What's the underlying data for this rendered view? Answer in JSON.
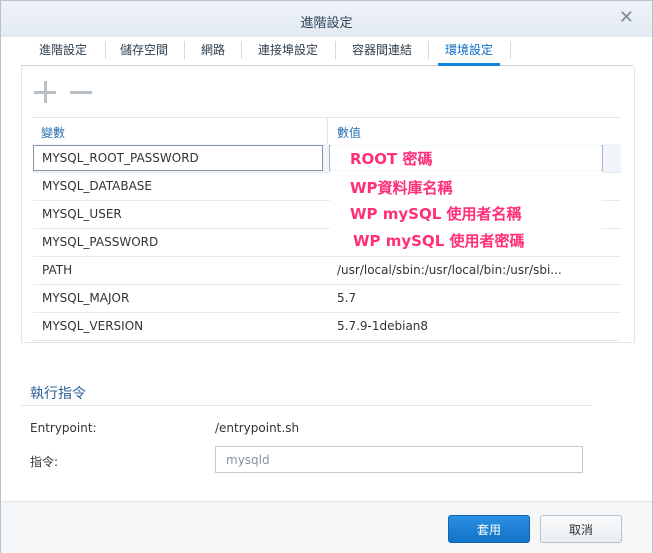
{
  "window": {
    "title": "進階設定"
  },
  "tabs": [
    {
      "label": "進階設定"
    },
    {
      "label": "儲存空間"
    },
    {
      "label": "網路"
    },
    {
      "label": "連接埠設定"
    },
    {
      "label": "容器間連結"
    },
    {
      "label": "環境設定",
      "active": true
    }
  ],
  "env": {
    "col_key": "變數",
    "col_value": "數值",
    "rows": [
      {
        "key": "MYSQL_ROOT_PASSWORD",
        "value": ""
      },
      {
        "key": "MYSQL_DATABASE",
        "value": ""
      },
      {
        "key": "MYSQL_USER",
        "value": ""
      },
      {
        "key": "MYSQL_PASSWORD",
        "value": ""
      },
      {
        "key": "PATH",
        "value": "/usr/local/sbin:/usr/local/bin:/usr/sbi..."
      },
      {
        "key": "MYSQL_MAJOR",
        "value": "5.7"
      },
      {
        "key": "MYSQL_VERSION",
        "value": "5.7.9-1debian8"
      }
    ]
  },
  "annotations": {
    "root": "ROOT 密碼",
    "db": "WP資料庫名稱",
    "user": "WP mySQL 使用者名稱",
    "password": "WP mySQL 使用者密碼",
    "color": "#ff2f7a"
  },
  "execution": {
    "title": "執行指令",
    "entrypoint_label": "Entrypoint:",
    "entrypoint_value": "/entrypoint.sh",
    "command_label": "指令:",
    "command_value": "mysqld"
  },
  "buttons": {
    "apply": "套用",
    "cancel": "取消"
  },
  "colors": {
    "accent": "#0a86db",
    "header_text": "#2a6fb2"
  }
}
